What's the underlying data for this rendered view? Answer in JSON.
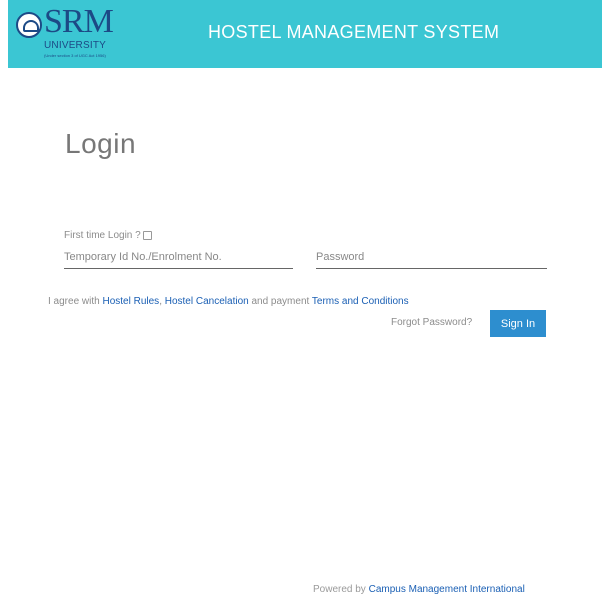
{
  "header": {
    "logo_name": "SRM",
    "logo_sub": "UNIVERSITY",
    "logo_tagline": "(Under section 3 of UGC Act 1956)",
    "title": "HOSTEL MANAGEMENT SYSTEM",
    "bg_color": "#3bc6d3"
  },
  "login": {
    "title": "Login",
    "first_time_label": "First time Login ?",
    "id_placeholder": "Temporary Id No./Enrolment No.",
    "password_placeholder": "Password"
  },
  "agreement": {
    "prefix": "I agree with ",
    "hostel_rules": "Hostel Rules",
    "sep": ", ",
    "hostel_cancelation": "Hostel Cancelation",
    "middle": " and payment ",
    "terms": "Terms and Conditions"
  },
  "actions": {
    "forgot_password": "Forgot Password?",
    "sign_in": "Sign In",
    "accent": "#2d8ecf"
  },
  "footer": {
    "prefix": "Powered by ",
    "company": "Campus Management International"
  }
}
